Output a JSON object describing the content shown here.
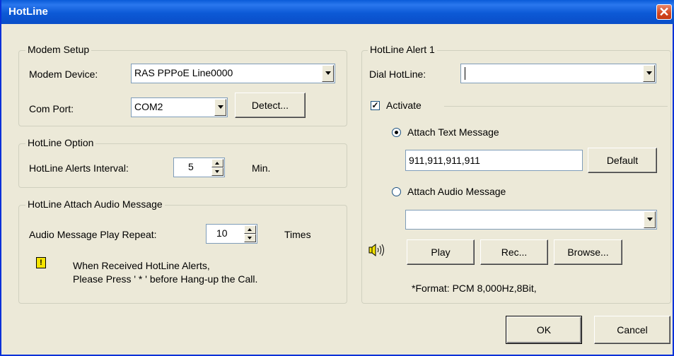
{
  "window": {
    "title": "HotLine"
  },
  "modem_setup": {
    "legend": "Modem Setup",
    "device_label": "Modem Device:",
    "device_value": "RAS PPPoE Line0000",
    "port_label": "Com Port:",
    "port_value": "COM2",
    "detect_button": "Detect..."
  },
  "hotline_option": {
    "legend": "HotLine Option",
    "interval_label": "HotLine Alerts Interval:",
    "interval_value": "5",
    "interval_unit": "Min."
  },
  "audio_message": {
    "legend": "HotLine Attach Audio Message",
    "repeat_label": "Audio Message Play Repeat:",
    "repeat_value": "10",
    "repeat_unit": "Times",
    "note_line1": "When Received HotLine Alerts,",
    "note_line2": "Please Press ' * ' before Hang-up the Call."
  },
  "alert1": {
    "legend": "HotLine Alert 1",
    "dial_label": "Dial HotLine:",
    "dial_value": "",
    "activate_label": "Activate",
    "activate_checked": true,
    "attach_text_label": "Attach Text Message",
    "text_message": "911,911,911,911",
    "default_button": "Default",
    "attach_audio_label": "Attach Audio Message",
    "audio_value": "",
    "play_button": "Play",
    "rec_button": "Rec...",
    "browse_button": "Browse...",
    "format_note": "*Format: PCM 8,000Hz,8Bit,"
  },
  "footer": {
    "ok_button": "OK",
    "cancel_button": "Cancel"
  }
}
